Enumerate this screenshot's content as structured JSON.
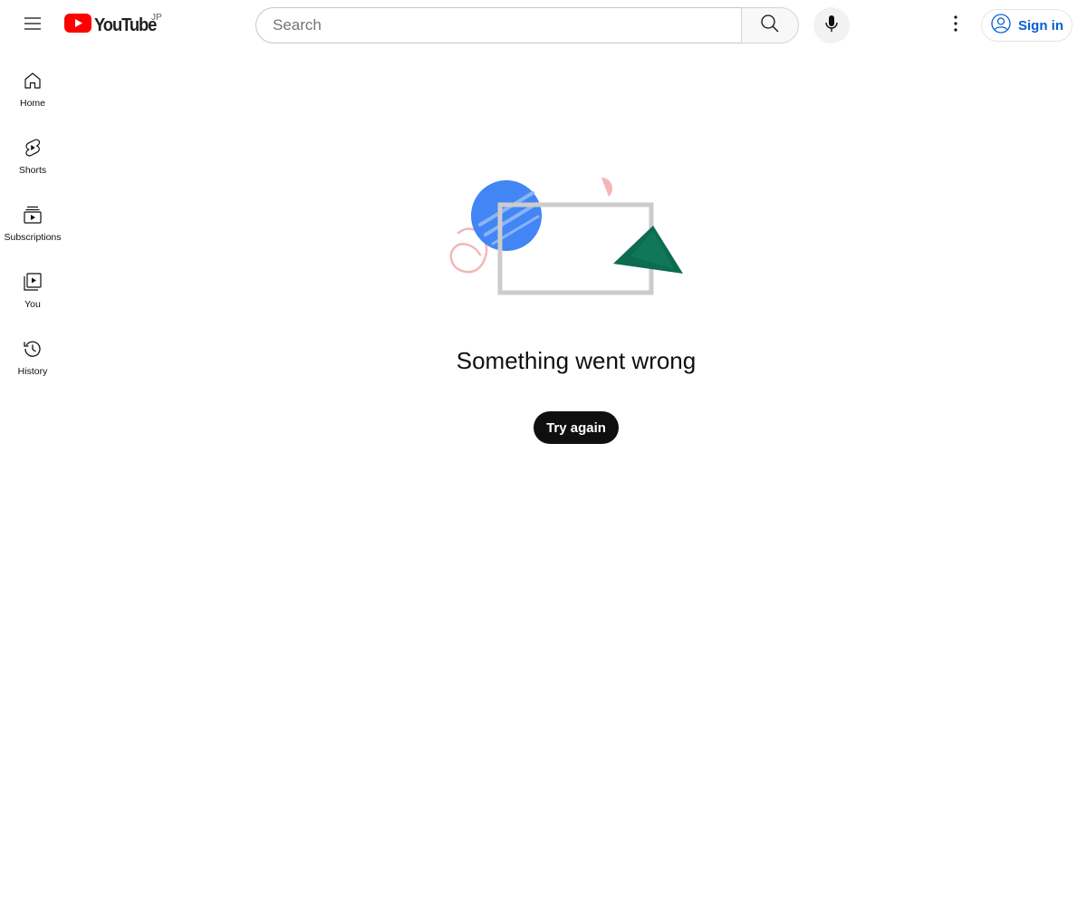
{
  "masthead": {
    "logo_text": "YouTube",
    "country_code": "JP",
    "search_placeholder": "Search",
    "search_value": "",
    "signin_label": "Sign in"
  },
  "guide": {
    "items": [
      {
        "label": "Home",
        "icon": "home-icon"
      },
      {
        "label": "Shorts",
        "icon": "shorts-icon"
      },
      {
        "label": "Subscriptions",
        "icon": "subscriptions-icon"
      },
      {
        "label": "You",
        "icon": "you-icon"
      },
      {
        "label": "History",
        "icon": "history-icon"
      }
    ]
  },
  "error": {
    "message": "Something went wrong",
    "retry_label": "Try again"
  },
  "colors": {
    "brand_red": "#ff0000",
    "link_blue": "#065fd4",
    "art_blue": "#4285f4",
    "art_green": "#0d6b4f",
    "art_pink": "#f5b5b5",
    "art_frame": "#cccccc"
  }
}
